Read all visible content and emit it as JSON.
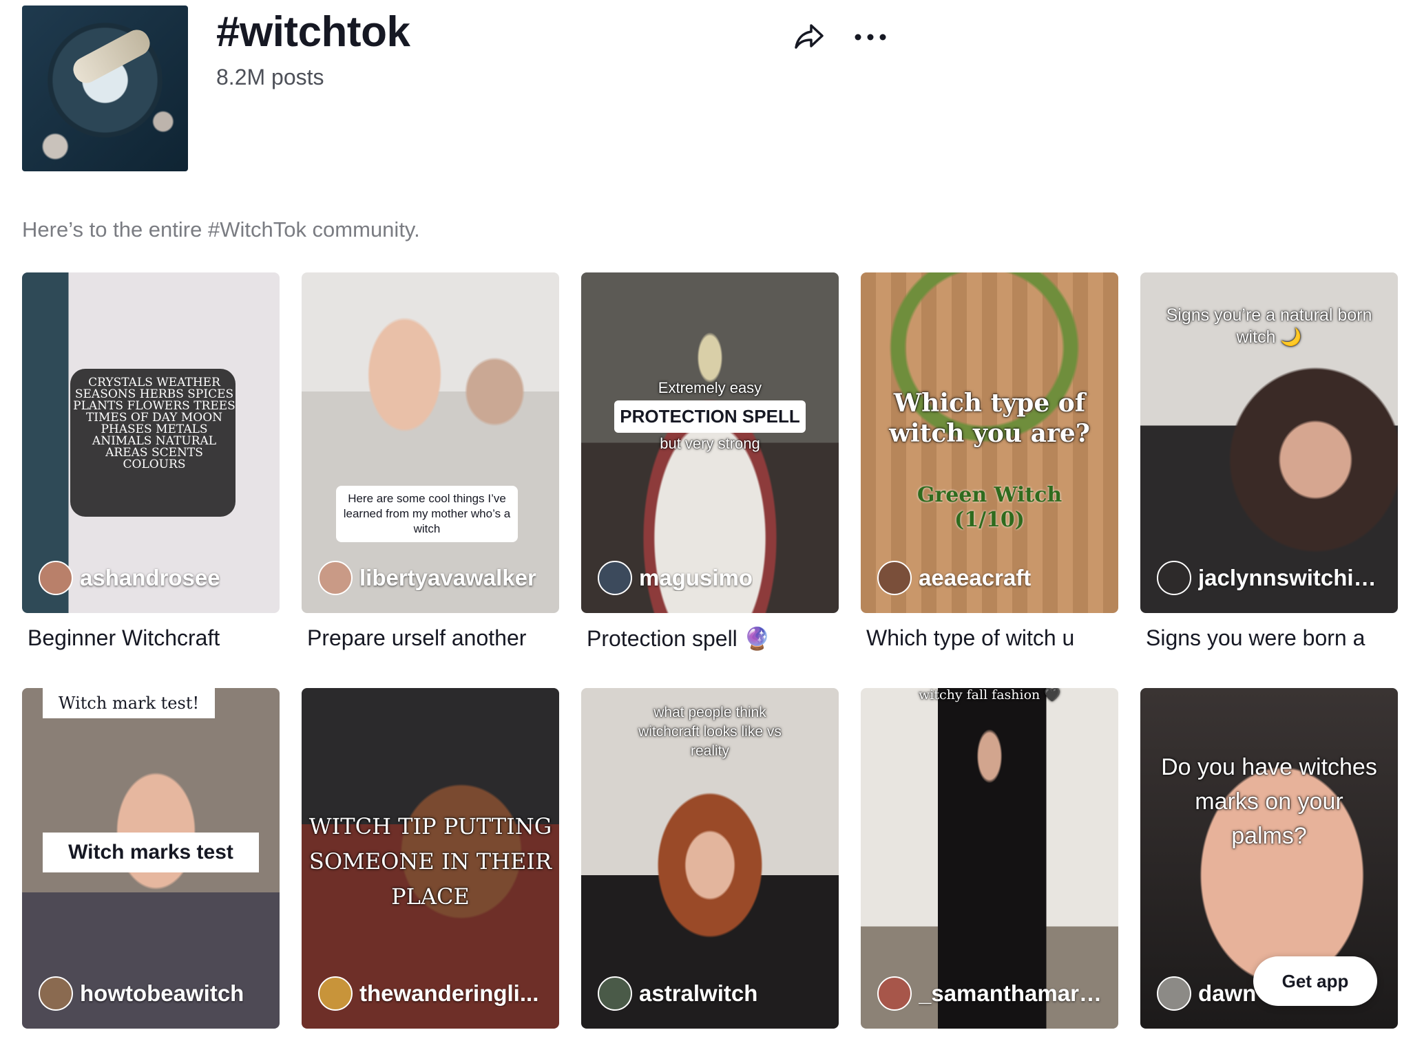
{
  "header": {
    "title": "#witchtok",
    "posts": "8.2M posts",
    "description": "Here’s to the entire #WitchTok community.",
    "share_icon": "share-arrow-icon",
    "more_icon": "ellipsis-icon"
  },
  "videos": [
    {
      "creator": "ashandrosee",
      "title": "Beginner Witchcraft",
      "overlay": "CRYSTALS WEATHER SEASONS HERBS SPICES PLANTS FLOWERS TREES TIMES OF DAY MOON PHASES METALS ANIMALS NATURAL AREAS SCENTS COLOURS"
    },
    {
      "creator": "libertyavawalker",
      "title": "Prepare urself another",
      "overlay": "Here are some cool things I’ve learned from my mother who’s a witch"
    },
    {
      "creator": "magusimo",
      "title": "Protection spell 🔮",
      "overlay_top": "Extremely easy",
      "overlay_main": "PROTECTION SPELL",
      "overlay_bottom": "but very strong"
    },
    {
      "creator": "aeaeacraft",
      "title": "Which type of witch u",
      "overlay_main": "Which type of witch you are?",
      "overlay_sub": "Green Witch (1/10)"
    },
    {
      "creator": "jaclynnswitchin...",
      "title": "Signs you were born a",
      "overlay": "Signs you’re a natural born witch 🌙"
    },
    {
      "creator": "howtobeawitch",
      "title": "",
      "overlay_top": "Witch mark test!",
      "overlay_main": "Witch marks test"
    },
    {
      "creator": "thewanderingli...",
      "title": "",
      "overlay": "WITCH TIP PUTTING SOMEONE IN THEIR PLACE"
    },
    {
      "creator": "astralwitch",
      "title": "",
      "overlay": "what people think witchcraft looks like vs reality"
    },
    {
      "creator": "_samanthamartin",
      "title": "",
      "overlay": "witchy fall fashion 🖤"
    },
    {
      "creator": "dawn",
      "title": "",
      "overlay": "Do you have witches marks on your palms?"
    }
  ],
  "get_app": "Get app",
  "colors": {
    "text": "#161823",
    "muted": "#7a7c82",
    "background": "#ffffff"
  }
}
